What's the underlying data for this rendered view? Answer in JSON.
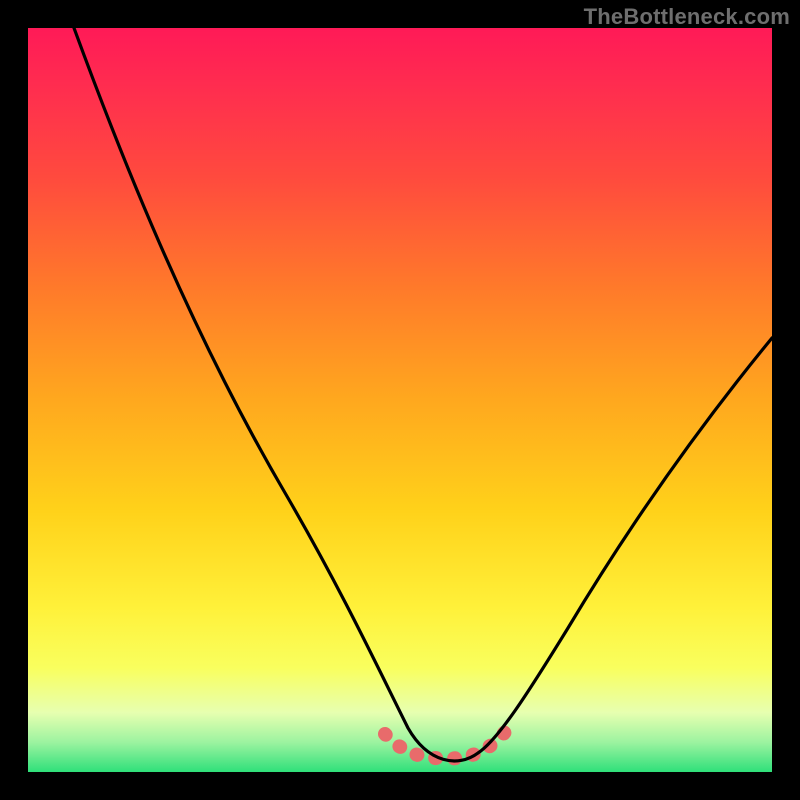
{
  "watermark": {
    "text": "TheBottleneck.com"
  },
  "colors": {
    "page_bg": "#000000",
    "curve_black": "#000000",
    "accent_coral": "#e86b6b",
    "gradient_stops": [
      "#ff1a57",
      "#ff2d4f",
      "#ff4a3e",
      "#ff7a2a",
      "#ffa81e",
      "#ffd21a",
      "#fff13a",
      "#f9ff5e",
      "#e7ffb0",
      "#9cf3a0",
      "#2fe07a"
    ]
  },
  "chart_data": {
    "type": "line",
    "title": "",
    "xlabel": "",
    "ylabel": "",
    "xlim": [
      0,
      100
    ],
    "ylim": [
      0,
      100
    ],
    "grid": false,
    "legend": false,
    "annotations": [],
    "series": [
      {
        "name": "bottleneck-curve-black",
        "color": "#000000",
        "x": [
          6,
          10,
          15,
          20,
          25,
          30,
          35,
          40,
          45,
          48,
          50,
          52,
          54,
          56,
          58,
          60,
          62,
          65,
          70,
          75,
          80,
          85,
          90,
          95,
          100
        ],
        "y": [
          100,
          93,
          84,
          75,
          66,
          57,
          48,
          39,
          27,
          18,
          11,
          6,
          3,
          2,
          2,
          2,
          3,
          5,
          10,
          18,
          26,
          34,
          42,
          50,
          58
        ]
      },
      {
        "name": "bottleneck-valley-highlight-coral",
        "color": "#e86b6b",
        "x": [
          48,
          50,
          52,
          54,
          56,
          58,
          60,
          62,
          64
        ],
        "y": [
          5,
          3,
          2,
          1.5,
          1.5,
          1.5,
          2,
          3,
          5
        ]
      }
    ]
  }
}
